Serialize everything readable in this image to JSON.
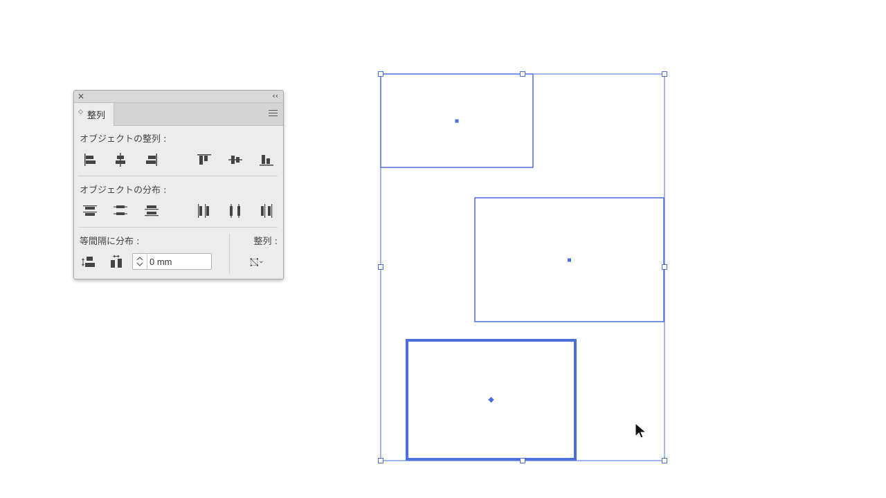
{
  "panel": {
    "close_glyph": "×",
    "collapse_glyph": "‹‹",
    "tab": {
      "arrow_glyph": "◇",
      "label": "整列"
    },
    "align_objects_label": "オブジェクトの整列 :",
    "distribute_objects_label": "オブジェクトの分布 :",
    "distribute_spacing_label": "等間隔に分布 :",
    "align_to_label": "整列 :",
    "spacing_value": "0 mm",
    "align_buttons": [
      "align-left",
      "align-horizontal-center",
      "align-right",
      "align-top",
      "align-vertical-center",
      "align-bottom"
    ],
    "distribute_buttons": [
      "distribute-top",
      "distribute-vertical-center",
      "distribute-bottom",
      "distribute-left",
      "distribute-horizontal-center",
      "distribute-right"
    ]
  },
  "canvas": {
    "accent_color": "#4a6fd8",
    "objects": [
      "rectangle-top-left",
      "rectangle-middle-right",
      "rectangle-bottom-key-object"
    ]
  }
}
